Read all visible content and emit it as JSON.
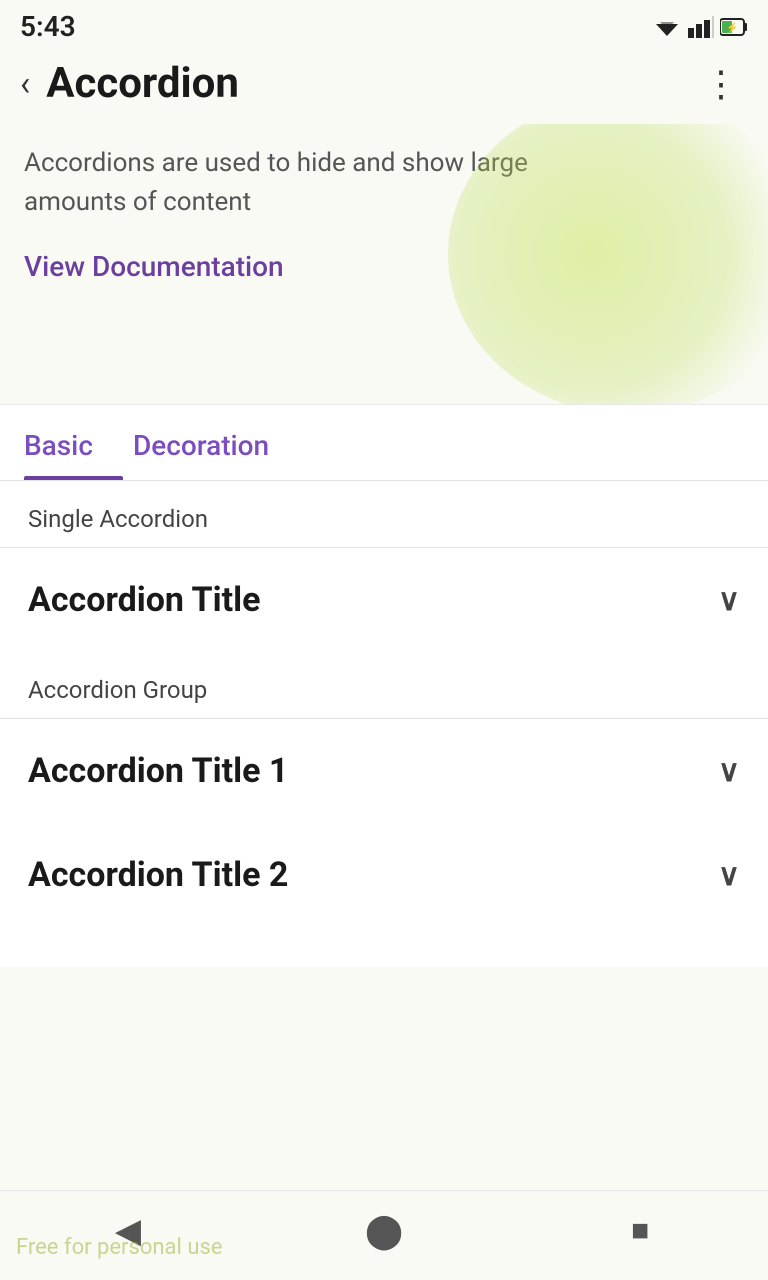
{
  "status": {
    "time": "5:43"
  },
  "header": {
    "back_label": "‹",
    "title": "Accordion",
    "more_label": "⋮"
  },
  "hero": {
    "description": "Accordions are used to hide and show large amounts of content",
    "docs_link": "View Documentation"
  },
  "tabs": [
    {
      "id": "basic",
      "label": "Basic",
      "active": true
    },
    {
      "id": "decoration",
      "label": "Decoration",
      "active": false
    }
  ],
  "sections": [
    {
      "id": "single",
      "label": "Single Accordion",
      "items": [
        {
          "id": "accordion-single-1",
          "title": "Accordion Title"
        }
      ]
    },
    {
      "id": "group",
      "label": "Accordion Group",
      "items": [
        {
          "id": "accordion-group-1",
          "title": "Accordion Title 1"
        },
        {
          "id": "accordion-group-2",
          "title": "Accordion Title 2"
        }
      ]
    }
  ],
  "bottom_nav": {
    "back_label": "◀",
    "home_label": "⬤",
    "square_label": "■"
  },
  "watermark": "Free for personal use",
  "colors": {
    "accent": "#6b3fa0",
    "text_primary": "#1a1a1a",
    "text_secondary": "#555",
    "divider": "#e0e0e0"
  }
}
